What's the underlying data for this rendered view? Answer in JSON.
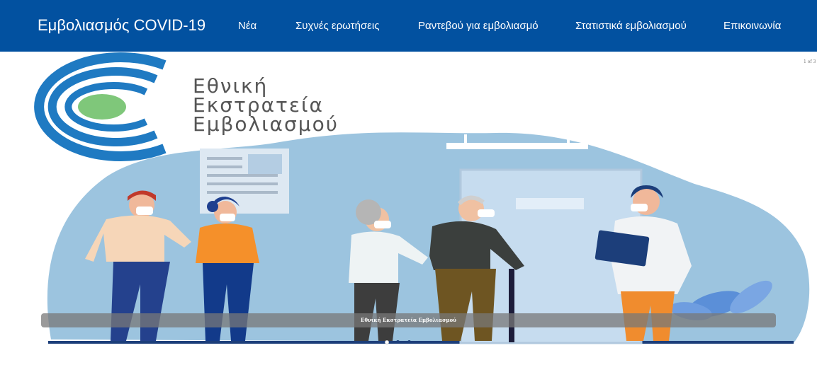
{
  "navbar": {
    "brand": "Εμβολιασμός COVID-19",
    "items": [
      {
        "label": "Νέα"
      },
      {
        "label": "Συχνές ερωτήσεις"
      },
      {
        "label": "Ραντεβού για εμβολιασμό"
      },
      {
        "label": "Στατιστικά εμβολιασμού"
      },
      {
        "label": "Επικοινωνία"
      }
    ]
  },
  "carousel": {
    "counter": "1 of 3",
    "caption": "Εθνική Εκστρατεία Εμβολιασμού",
    "logo_lines": [
      "Εθνική",
      "Εκστρατεία",
      "Εμβολιασμού"
    ]
  },
  "colors": {
    "nav_bg": "#0251a0",
    "logo_blue": "#1f7ac2",
    "logo_green": "#7fc77a",
    "illustration_bg": "#9cc4df"
  }
}
